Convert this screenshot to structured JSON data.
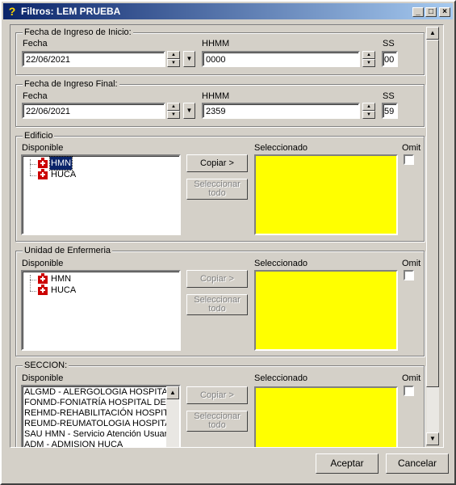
{
  "window": {
    "title": "Filtros: LEM PRUEBA",
    "icon": "question-icon",
    "controls": [
      "minimize-icon",
      "maximize-icon",
      "close-icon"
    ]
  },
  "inicio": {
    "group_title": "Fecha de Ingreso de Inicio:",
    "fecha_label": "Fecha",
    "fecha_value": "22/06/2021",
    "hhmm_label": "HHMM",
    "hhmm_value": "0000",
    "ss_label": "SS",
    "ss_value": "00"
  },
  "final": {
    "group_title": "Fecha de Ingreso Final:",
    "fecha_label": "Fecha",
    "fecha_value": "22/06/2021",
    "hhmm_label": "HHMM",
    "hhmm_value": "2359",
    "ss_label": "SS",
    "ss_value": "59"
  },
  "edificio": {
    "group_title": "Edificio",
    "disponible_label": "Disponible",
    "seleccionado_label": "Seleccionado",
    "omit_label": "Omit",
    "items": [
      "HMN",
      "HUCA"
    ],
    "selected_item": "HMN",
    "copy_label": "Copiar >",
    "select_all_label": "Seleccionar todo"
  },
  "unidad": {
    "group_title": "Unidad de Enfermeria",
    "disponible_label": "Disponible",
    "seleccionado_label": "Seleccionado",
    "omit_label": "Omit",
    "items": [
      "HMN",
      "HUCA"
    ],
    "copy_label": "Copiar >",
    "select_all_label": "Seleccionar todo"
  },
  "seccion": {
    "group_title": "SECCION:",
    "disponible_label": "Disponible",
    "seleccionado_label": "Seleccionado",
    "omit_label": "Omit",
    "items": [
      "ALGMD - ALERGOLOGIA HOSPITAL",
      "FONMD-FONIATRÍA HOSPITAL DE",
      "REHMD-REHABILITACIÓN HOSPIT.",
      "REUMD-REUMATOLOGIA HOSPITA",
      "SAU HMN - Servicio Atención Usuari",
      "ADM - ADMISION HUCA"
    ],
    "copy_label": "Copiar >",
    "select_all_label": "Seleccionar todo"
  },
  "footer": {
    "accept_label": "Aceptar",
    "cancel_label": "Cancelar"
  },
  "colors": {
    "selected_bg": "#ffff00",
    "title_bar": "#0a246a",
    "highlight": "#0a246a"
  }
}
